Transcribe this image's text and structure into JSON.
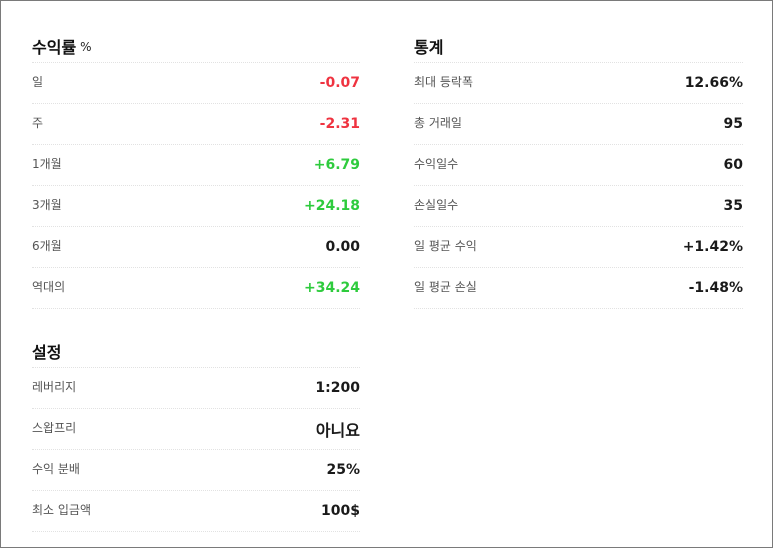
{
  "returns": {
    "title": "수익률",
    "unit": "%",
    "rows": [
      {
        "label": "일",
        "value": "-0.07",
        "tone": "neg"
      },
      {
        "label": "주",
        "value": "-2.31",
        "tone": "neg"
      },
      {
        "label": "1개월",
        "value": "+6.79",
        "tone": "pos"
      },
      {
        "label": "3개월",
        "value": "+24.18",
        "tone": "pos"
      },
      {
        "label": "6개월",
        "value": "0.00",
        "tone": "neutral"
      },
      {
        "label": "역대의",
        "value": "+34.24",
        "tone": "pos"
      }
    ]
  },
  "settings": {
    "title": "설정",
    "rows": [
      {
        "label": "레버리지",
        "value": "1:200"
      },
      {
        "label": "스왑프리",
        "value": "아니요"
      },
      {
        "label": "수익 분배",
        "value": "25%"
      },
      {
        "label": "최소 입금액",
        "value": "100$"
      }
    ]
  },
  "stats": {
    "title": "통계",
    "rows": [
      {
        "label": "최대 등락폭",
        "value": "12.66%"
      },
      {
        "label": "총 거래일",
        "value": "95"
      },
      {
        "label": "수익일수",
        "value": "60"
      },
      {
        "label": "손실일수",
        "value": "35"
      },
      {
        "label": "일 평균 수익",
        "value": "+1.42%"
      },
      {
        "label": "일 평균 손실",
        "value": "-1.48%"
      }
    ]
  },
  "colors": {
    "negative": "#ef3340",
    "positive": "#2ecb3d",
    "text": "#1a1a1a"
  }
}
